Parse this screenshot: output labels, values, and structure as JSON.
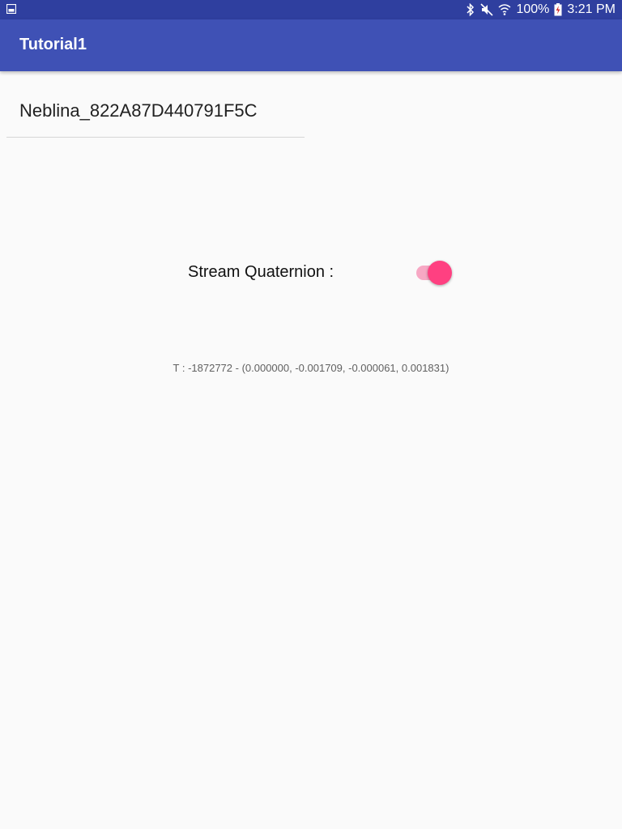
{
  "status_bar": {
    "left_icon": "gallery-icon",
    "icons": [
      "bluetooth-icon",
      "mute-icon",
      "wifi-icon"
    ],
    "battery_text": "100%",
    "battery_icon": "battery-charging-icon",
    "time": "3:21 PM",
    "colors": {
      "background": "#2f3f9f",
      "text": "#ffffff"
    }
  },
  "app_bar": {
    "title": "Tutorial1",
    "color": "#3f51b5"
  },
  "device": {
    "name": "Neblina_822A87D440791F5C"
  },
  "stream": {
    "label": "Stream Quaternion :",
    "enabled": true,
    "switch_color": "#ff4081"
  },
  "quaternion_readout": {
    "text": "T : -1872772 - (0.000000, -0.001709, -0.000061, 0.001831)"
  }
}
